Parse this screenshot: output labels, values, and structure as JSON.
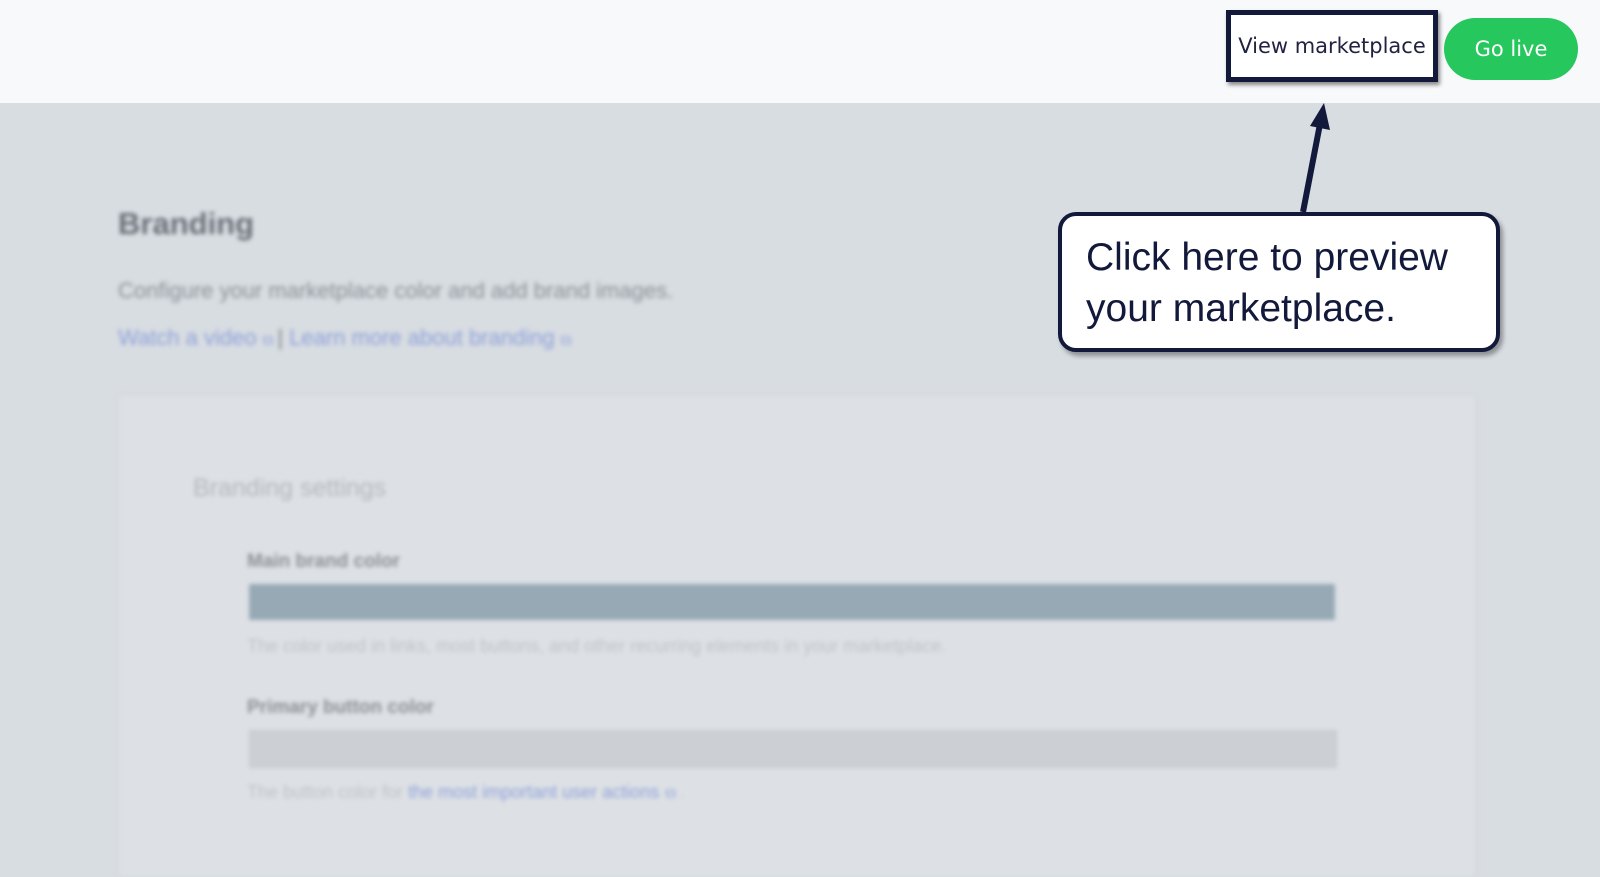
{
  "header": {
    "view_marketplace_label": "View marketplace",
    "go_live_label": "Go live"
  },
  "page": {
    "title": "Branding",
    "description": "Configure your marketplace color and add brand images.",
    "link_video": "Watch a video",
    "separator": "|",
    "link_learn": "Learn more about branding",
    "external_icon": "⧉"
  },
  "card": {
    "title": "Branding settings",
    "fields": [
      {
        "label": "Main brand color",
        "help": "The color used in links, most buttons, and other recurring elements in your marketplace.",
        "swatch": "#97a9b5"
      },
      {
        "label": "Primary button color",
        "help_prefix": "The button color for ",
        "help_link": "the most important user actions",
        "help_suffix": ".",
        "swatch": "#ccd0d4"
      }
    ]
  },
  "callout": {
    "text": "Click here to preview your marketplace."
  },
  "colors": {
    "accent_navy": "#13193a",
    "go_live_green": "#26c75d",
    "link_blue": "#8ea0d8"
  }
}
